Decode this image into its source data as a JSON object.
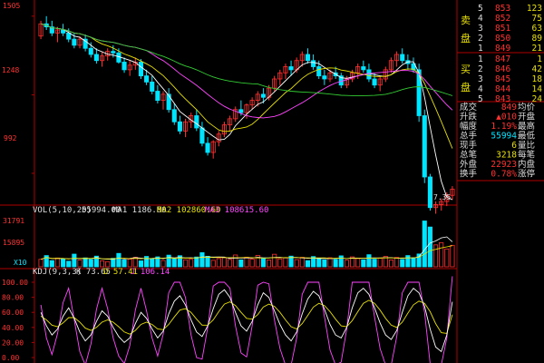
{
  "colors": {
    "background": "#000000",
    "frame": "#b00000",
    "up": "#ff3030",
    "down": "#00e5ff",
    "ma5": "#ffffff",
    "ma10": "#e8e000",
    "ma20": "#ff44ff",
    "ma60": "#33cc33",
    "axis_text": "#ff3030",
    "label_white": "#dddddd",
    "label_yellow": "#e8e000",
    "label_cyan": "#00e5ff",
    "label_green": "#33cc33",
    "label_magenta": "#ff44ff"
  },
  "price_axis": {
    "labels": [
      "1505",
      "1248",
      "992"
    ]
  },
  "header_marker": "1505",
  "low_annotation": "7.35",
  "volume_panel": {
    "title": "VOL(5,10,20)",
    "vol": "55994.00",
    "ma1": "MA1 1186.80",
    "ma2": "MA2 102860.60",
    "ma3": "MA3 108615.60",
    "axis_labels": [
      "31791",
      "15895",
      "X10"
    ]
  },
  "kdj_panel": {
    "title": "KDJ(9,3,3)",
    "k": "K 73.65",
    "d": "D 57.41",
    "j": "J 106.14",
    "axis_labels": [
      "100.00",
      "80.00",
      "60.00",
      "40.00",
      "20.00",
      "0.00"
    ]
  },
  "sell_book": {
    "side_label": "卖盘",
    "levels": [
      {
        "level": "5",
        "price": "853",
        "volume": "123"
      },
      {
        "level": "4",
        "price": "852",
        "volume": "75"
      },
      {
        "level": "3",
        "price": "851",
        "volume": "63"
      },
      {
        "level": "2",
        "price": "850",
        "volume": "89"
      },
      {
        "level": "1",
        "price": "849",
        "volume": "21"
      }
    ]
  },
  "buy_book": {
    "side_label": "买盘",
    "levels": [
      {
        "level": "1",
        "price": "847",
        "volume": "1"
      },
      {
        "level": "2",
        "price": "846",
        "volume": "42"
      },
      {
        "level": "3",
        "price": "845",
        "volume": "18"
      },
      {
        "level": "4",
        "price": "844",
        "volume": "14"
      },
      {
        "level": "5",
        "price": "843",
        "volume": "24"
      }
    ]
  },
  "stats": [
    {
      "label": "成交",
      "value": "849",
      "label2": "均价"
    },
    {
      "label": "升跌",
      "value": "▲010",
      "label2": "开盘"
    },
    {
      "label": "幅度",
      "value": "1.19%",
      "label2": "最高"
    },
    {
      "label": "总手",
      "value": "55994",
      "label2": "最低"
    },
    {
      "label": "现手",
      "value": "6",
      "label2": "量比"
    },
    {
      "label": "总笔",
      "value": "3218",
      "label2": "每笔"
    },
    {
      "label": "外盘",
      "value": "22923",
      "label2": "内盘"
    },
    {
      "label": "换手",
      "value": "0.78%",
      "label2": "涨停"
    }
  ],
  "chart_data": {
    "type": "candlestick",
    "price_ylim": [
      900,
      1540
    ],
    "price_tick_values": [
      1505,
      1248,
      992
    ],
    "ohlc": [
      [
        1440,
        1490,
        1430,
        1480
      ],
      [
        1480,
        1505,
        1460,
        1470
      ],
      [
        1470,
        1490,
        1440,
        1450
      ],
      [
        1450,
        1470,
        1420,
        1460
      ],
      [
        1460,
        1480,
        1440,
        1450
      ],
      [
        1450,
        1465,
        1420,
        1430
      ],
      [
        1430,
        1450,
        1400,
        1410
      ],
      [
        1410,
        1440,
        1400,
        1430
      ],
      [
        1430,
        1445,
        1390,
        1400
      ],
      [
        1400,
        1420,
        1370,
        1380
      ],
      [
        1380,
        1400,
        1350,
        1360
      ],
      [
        1360,
        1390,
        1340,
        1375
      ],
      [
        1375,
        1400,
        1360,
        1390
      ],
      [
        1390,
        1410,
        1370,
        1385
      ],
      [
        1385,
        1400,
        1350,
        1355
      ],
      [
        1355,
        1370,
        1320,
        1330
      ],
      [
        1330,
        1360,
        1310,
        1345
      ],
      [
        1345,
        1370,
        1330,
        1355
      ],
      [
        1355,
        1365,
        1300,
        1310
      ],
      [
        1310,
        1330,
        1280,
        1290
      ],
      [
        1290,
        1310,
        1250,
        1260
      ],
      [
        1260,
        1280,
        1220,
        1230
      ],
      [
        1230,
        1260,
        1200,
        1250
      ],
      [
        1250,
        1270,
        1190,
        1200
      ],
      [
        1200,
        1220,
        1150,
        1160
      ],
      [
        1160,
        1180,
        1120,
        1130
      ],
      [
        1130,
        1170,
        1110,
        1160
      ],
      [
        1160,
        1190,
        1140,
        1180
      ],
      [
        1180,
        1200,
        1130,
        1140
      ],
      [
        1140,
        1160,
        1080,
        1090
      ],
      [
        1090,
        1110,
        1050,
        1060
      ],
      [
        1060,
        1100,
        1040,
        1095
      ],
      [
        1095,
        1130,
        1080,
        1120
      ],
      [
        1120,
        1160,
        1110,
        1150
      ],
      [
        1150,
        1180,
        1130,
        1170
      ],
      [
        1170,
        1210,
        1160,
        1200
      ],
      [
        1200,
        1230,
        1180,
        1190
      ],
      [
        1190,
        1220,
        1170,
        1215
      ],
      [
        1215,
        1240,
        1200,
        1230
      ],
      [
        1230,
        1260,
        1210,
        1250
      ],
      [
        1250,
        1270,
        1220,
        1240
      ],
      [
        1240,
        1280,
        1230,
        1270
      ],
      [
        1270,
        1310,
        1260,
        1300
      ],
      [
        1300,
        1330,
        1280,
        1320
      ],
      [
        1320,
        1350,
        1300,
        1340
      ],
      [
        1340,
        1360,
        1310,
        1330
      ],
      [
        1330,
        1370,
        1320,
        1360
      ],
      [
        1360,
        1390,
        1340,
        1380
      ],
      [
        1380,
        1400,
        1350,
        1360
      ],
      [
        1360,
        1380,
        1330,
        1340
      ],
      [
        1340,
        1360,
        1300,
        1310
      ],
      [
        1310,
        1330,
        1280,
        1300
      ],
      [
        1300,
        1330,
        1290,
        1320
      ],
      [
        1320,
        1340,
        1300,
        1310
      ],
      [
        1310,
        1320,
        1270,
        1280
      ],
      [
        1280,
        1310,
        1270,
        1300
      ],
      [
        1300,
        1330,
        1290,
        1320
      ],
      [
        1320,
        1350,
        1300,
        1340
      ],
      [
        1340,
        1360,
        1320,
        1330
      ],
      [
        1330,
        1350,
        1290,
        1300
      ],
      [
        1300,
        1320,
        1270,
        1280
      ],
      [
        1280,
        1310,
        1260,
        1300
      ],
      [
        1300,
        1340,
        1290,
        1330
      ],
      [
        1330,
        1370,
        1320,
        1360
      ],
      [
        1360,
        1390,
        1340,
        1380
      ],
      [
        1380,
        1400,
        1350,
        1360
      ],
      [
        1360,
        1380,
        1330,
        1350
      ],
      [
        1350,
        1370,
        1320,
        1330
      ],
      [
        1330,
        1350,
        1160,
        1180
      ],
      [
        1180,
        1200,
        960,
        980
      ],
      [
        980,
        990,
        870,
        880
      ],
      [
        880,
        900,
        860,
        890
      ],
      [
        890,
        910,
        870,
        900
      ],
      [
        900,
        930,
        885,
        920
      ],
      [
        920,
        950,
        905,
        940
      ]
    ],
    "volume_ylim": [
      0,
      34000
    ],
    "volume_tick_values": [
      31791,
      15895
    ],
    "volume": [
      5200,
      7800,
      4300,
      6100,
      5600,
      3900,
      8800,
      4700,
      6200,
      5100,
      7400,
      4200,
      3600,
      5900,
      9300,
      4800,
      5300,
      6600,
      4100,
      7200,
      5800,
      6900,
      4400,
      8100,
      5600,
      7700,
      4900,
      5200,
      6800,
      9800,
      7300,
      4500,
      5700,
      6300,
      5100,
      8200,
      4800,
      6700,
      5400,
      7900,
      6100,
      4700,
      8700,
      5500,
      6200,
      7400,
      5000,
      6600,
      4300,
      7100,
      5900,
      4800,
      6300,
      5200,
      7600,
      4600,
      6900,
      5800,
      4900,
      8400,
      5300,
      6100,
      7200,
      4700,
      6500,
      5100,
      7800,
      6300,
      8900,
      31791,
      27600,
      15200,
      16800,
      12400,
      14900
    ],
    "kdj_ylim": [
      0,
      100
    ],
    "kdj_tick_values": [
      100,
      80,
      60,
      40,
      20,
      0
    ],
    "k": [
      60,
      42,
      30,
      38,
      55,
      66,
      52,
      34,
      22,
      30,
      48,
      62,
      55,
      40,
      28,
      20,
      26,
      45,
      60,
      52,
      38,
      26,
      35,
      58,
      75,
      82,
      70,
      50,
      34,
      28,
      42,
      65,
      84,
      90,
      80,
      60,
      42,
      35,
      48,
      70,
      86,
      80,
      62,
      44,
      30,
      22,
      34,
      58,
      78,
      88,
      82,
      64,
      44,
      30,
      26,
      40,
      66,
      86,
      92,
      84,
      66,
      46,
      30,
      24,
      36,
      60,
      82,
      92,
      86,
      68,
      38,
      14,
      8,
      30,
      74
    ],
    "d": [
      55,
      50,
      43,
      41,
      46,
      53,
      53,
      47,
      39,
      36,
      40,
      47,
      50,
      47,
      41,
      34,
      31,
      36,
      44,
      47,
      44,
      38,
      37,
      44,
      54,
      63,
      65,
      60,
      51,
      43,
      43,
      50,
      61,
      71,
      74,
      69,
      60,
      52,
      51,
      57,
      67,
      71,
      68,
      60,
      50,
      41,
      38,
      45,
      56,
      67,
      72,
      69,
      61,
      51,
      42,
      41,
      49,
      61,
      72,
      76,
      72,
      63,
      52,
      43,
      40,
      47,
      59,
      70,
      75,
      72,
      61,
      45,
      33,
      32,
      57
    ],
    "j": [
      70,
      26,
      4,
      32,
      73,
      92,
      50,
      8,
      -10,
      18,
      64,
      92,
      65,
      26,
      2,
      -8,
      16,
      63,
      92,
      62,
      26,
      2,
      31,
      86,
      100,
      100,
      80,
      30,
      0,
      -2,
      40,
      95,
      100,
      100,
      92,
      42,
      6,
      1,
      42,
      96,
      100,
      98,
      50,
      12,
      -10,
      -16,
      26,
      84,
      100,
      100,
      100,
      54,
      10,
      -10,
      -6,
      38,
      100,
      100,
      100,
      100,
      54,
      12,
      -14,
      -14,
      28,
      86,
      100,
      100,
      100,
      60,
      -8,
      -48,
      -34,
      26,
      108
    ]
  }
}
